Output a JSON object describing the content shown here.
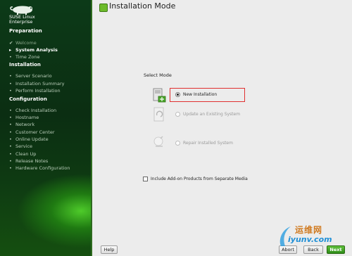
{
  "sidebar": {
    "brand_line1": "SUSE Linux",
    "brand_line2": "Enterprise",
    "sections": [
      {
        "title": "Preparation",
        "items": [
          {
            "label": "Welcome",
            "state": "done"
          },
          {
            "label": "System Analysis",
            "state": "current"
          },
          {
            "label": "Time Zone",
            "state": "pending"
          }
        ]
      },
      {
        "title": "Installation",
        "items": [
          {
            "label": "Server Scenario",
            "state": "pending"
          },
          {
            "label": "Installation Summary",
            "state": "pending"
          },
          {
            "label": "Perform Installation",
            "state": "pending"
          }
        ]
      },
      {
        "title": "Configuration",
        "items": [
          {
            "label": "Check Installation",
            "state": "pending"
          },
          {
            "label": "Hostname",
            "state": "pending"
          },
          {
            "label": "Network",
            "state": "pending"
          },
          {
            "label": "Customer Center",
            "state": "pending"
          },
          {
            "label": "Online Update",
            "state": "pending"
          },
          {
            "label": "Service",
            "state": "pending"
          },
          {
            "label": "Clean Up",
            "state": "pending"
          },
          {
            "label": "Release Notes",
            "state": "pending"
          },
          {
            "label": "Hardware Configuration",
            "state": "pending"
          }
        ]
      }
    ]
  },
  "main": {
    "title": "Installation Mode",
    "group_label": "Select Mode",
    "options": [
      {
        "label": "New Installation",
        "selected": true,
        "enabled": true
      },
      {
        "label": "Update an Existing System",
        "selected": false,
        "enabled": false
      },
      {
        "label": "Repair Installed System",
        "selected": false,
        "enabled": false
      }
    ],
    "addon_checkbox": {
      "label": "Include Add-on Products from Separate Media",
      "checked": false
    }
  },
  "buttons": {
    "help": "Help",
    "abort": "Abort",
    "back": "Back",
    "next": "Next"
  },
  "watermark": {
    "line1": "运维网",
    "line2": "iyunv.com"
  },
  "colors": {
    "accent_green": "#3aa320",
    "highlight_red": "#e03030",
    "sidebar_bg": "#0c3a18"
  }
}
